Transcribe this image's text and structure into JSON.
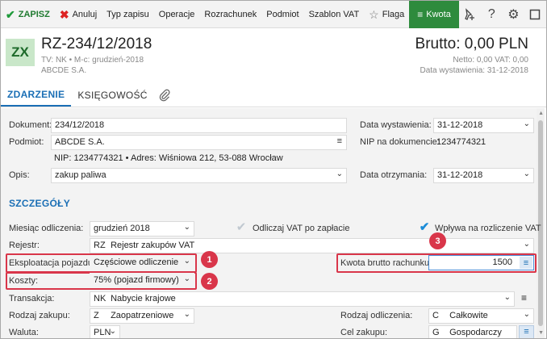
{
  "toolbar": {
    "save": "ZAPISZ",
    "cancel": "Anuluj",
    "record_type": "Typ zapisu",
    "operations": "Operacje",
    "settlement": "Rozrachunek",
    "entity": "Podmiot",
    "vat_template": "Szablon VAT",
    "flag": "Flaga",
    "amount": "Kwota"
  },
  "header": {
    "badge": "ZX",
    "title": "RZ-234/12/2018",
    "subtitle": "TV: NK  •  M-c: grudzień-2018",
    "company": "ABCDE S.A.",
    "brutto": "Brutto: 0,00 PLN",
    "netto": "Netto: 0,00 VAT: 0,00",
    "issue_date": "Data wystawienia: 31-12-2018"
  },
  "tabs": [
    {
      "label": "ZDARZENIE"
    },
    {
      "label": "KSIĘGOWOŚĆ"
    }
  ],
  "form": {
    "document_label": "Dokument:",
    "document_value": "234/12/2018",
    "entity_label": "Podmiot:",
    "entity_value": "ABCDE S.A.",
    "nip_line": "NIP: 1234774321  •  Adres: Wiśniowa 212, 53-088 Wrocław",
    "desc_label": "Opis:",
    "desc_value": "zakup paliwa",
    "issue_label": "Data wystawienia:",
    "issue_value": "31-12-2018",
    "nip_doc_label": "NIP na dokumencie:",
    "nip_doc_value": "1234774321",
    "receipt_label": "Data otrzymania:",
    "receipt_value": "31-12-2018"
  },
  "details": {
    "section_title": "SZCZEGÓŁY",
    "month_label": "Miesiąc odliczenia:",
    "month_value": "grudzień 2018",
    "deduct_on_payment": "Odliczaj VAT po zapłacie",
    "affects_vat": "Wpływa na rozliczenie VAT",
    "register_label": "Rejestr:",
    "register_code": "RZ",
    "register_value": "Rejestr zakupów VAT",
    "vehicle_label": "Eksploatacja pojazdu:",
    "vehicle_value": "Częściowe odliczenie",
    "costs_label": "Koszty:",
    "costs_value": "75% (pojazd firmowy)",
    "gross_label": "Kwota brutto rachunku:",
    "gross_value": "1500",
    "transaction_label": "Transakcja:",
    "transaction_code": "NK",
    "transaction_value": "Nabycie krajowe",
    "purchase_label": "Rodzaj zakupu:",
    "purchase_code": "Z",
    "purchase_value": "Zaopatrzeniowe",
    "deduction_type_label": "Rodzaj odliczenia:",
    "deduction_type_code": "C",
    "deduction_type_value": "Całkowite",
    "currency_label": "Waluta:",
    "currency_value": "PLN",
    "purpose_label": "Cel zakupu:",
    "purpose_code": "G",
    "purpose_value": "Gospodarczy"
  },
  "callouts": [
    "1",
    "2",
    "3"
  ],
  "colors": {
    "accent": "#1b6fb5",
    "save_green": "#1f9a3a",
    "kwota_bg": "#2e8b3d",
    "highlight": "#d9364a",
    "badge_bg": "#c9e7c9"
  }
}
